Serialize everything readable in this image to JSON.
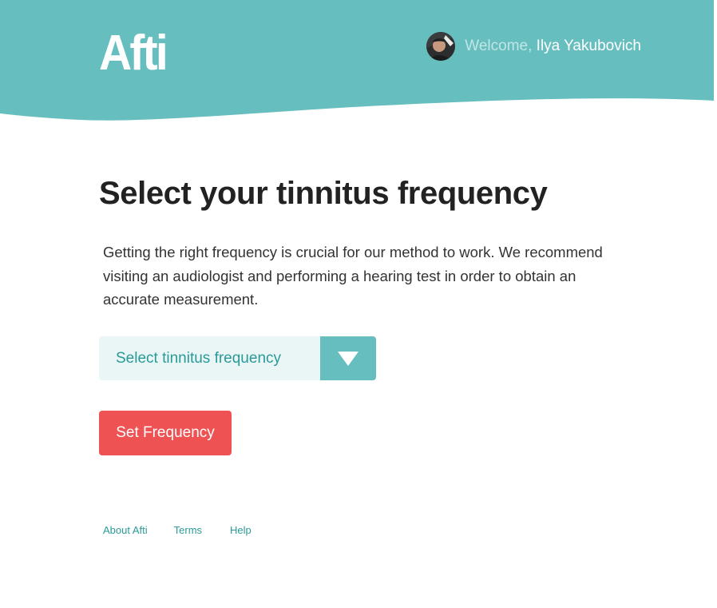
{
  "header": {
    "logo": "Afti",
    "welcome_prefix": "Welcome,",
    "user_name": "Ilya Yakubovich",
    "background_color": "#67bebf"
  },
  "main": {
    "title": "Select your tinnitus frequency",
    "description": "Getting the right frequency is crucial for our method to work. We recommend visiting an audiologist and performing a hearing test in order to obtain an accurate measurement.",
    "frequency_select": {
      "value": "Select tinnitus frequency",
      "icon": "triangle-down-icon"
    },
    "set_button_label": "Set Frequency",
    "button_color": "#ee5253"
  },
  "footer": {
    "links": [
      "About Afti",
      "Terms",
      "Help"
    ]
  }
}
